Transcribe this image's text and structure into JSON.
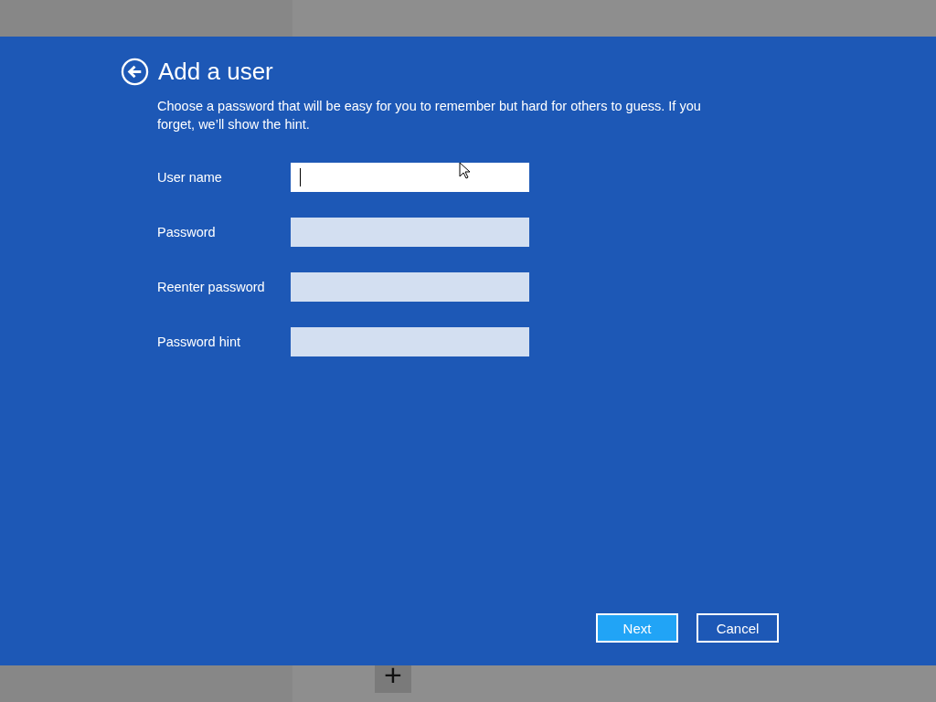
{
  "background": {
    "add_user_button": {
      "label": "+"
    }
  },
  "dialog": {
    "title": "Add a user",
    "description": "Choose a password that will be easy for you to remember but hard for others to guess. If you forget, we’ll show the hint.",
    "fields": [
      {
        "label": "User name",
        "focused": true
      },
      {
        "label": "Password",
        "focused": false
      },
      {
        "label": "Reenter password",
        "focused": false
      },
      {
        "label": "Password hint",
        "focused": false
      }
    ],
    "buttons": [
      {
        "label": "Next",
        "default": true
      },
      {
        "label": "Cancel",
        "default": false
      }
    ]
  }
}
